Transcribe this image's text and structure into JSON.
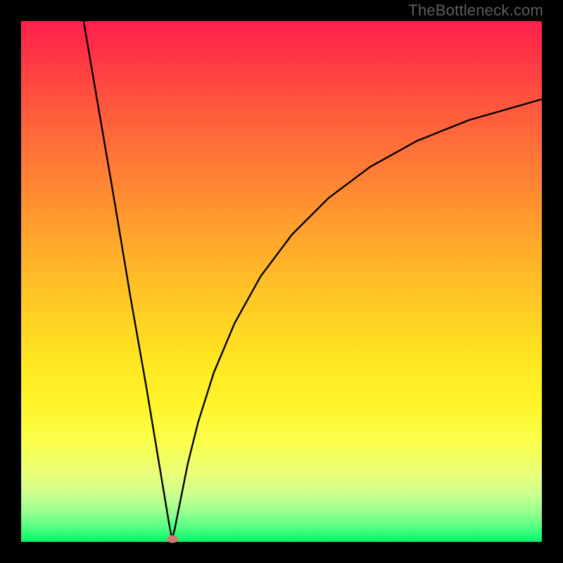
{
  "watermark": "TheBottleneck.com",
  "chart_data": {
    "type": "line",
    "title": "",
    "xlabel": "",
    "ylabel": "",
    "xlim": [
      0,
      100
    ],
    "ylim": [
      0,
      100
    ],
    "grid": false,
    "legend": false,
    "bottleneck_point": {
      "x": 29,
      "y": 0.5
    },
    "curve_points": [
      {
        "x": 12.0,
        "y": 100.0
      },
      {
        "x": 15.0,
        "y": 82.5
      },
      {
        "x": 18.0,
        "y": 65.0
      },
      {
        "x": 21.0,
        "y": 47.0
      },
      {
        "x": 24.0,
        "y": 30.0
      },
      {
        "x": 26.0,
        "y": 18.0
      },
      {
        "x": 27.5,
        "y": 9.0
      },
      {
        "x": 28.5,
        "y": 3.0
      },
      {
        "x": 29.0,
        "y": 0.5
      },
      {
        "x": 29.5,
        "y": 2.5
      },
      {
        "x": 30.5,
        "y": 7.5
      },
      {
        "x": 32.0,
        "y": 15.0
      },
      {
        "x": 34.0,
        "y": 23.0
      },
      {
        "x": 37.0,
        "y": 32.5
      },
      {
        "x": 41.0,
        "y": 42.0
      },
      {
        "x": 46.0,
        "y": 51.0
      },
      {
        "x": 52.0,
        "y": 59.0
      },
      {
        "x": 59.0,
        "y": 66.0
      },
      {
        "x": 67.0,
        "y": 72.0
      },
      {
        "x": 76.0,
        "y": 77.0
      },
      {
        "x": 86.0,
        "y": 81.0
      },
      {
        "x": 100.0,
        "y": 85.0
      }
    ],
    "gradient_colors": {
      "top": "#ff1f4a",
      "middle": "#ffe822",
      "bottom": "#0af06a"
    },
    "curve_color": "#000000",
    "marker_color": "#cf7a77"
  }
}
